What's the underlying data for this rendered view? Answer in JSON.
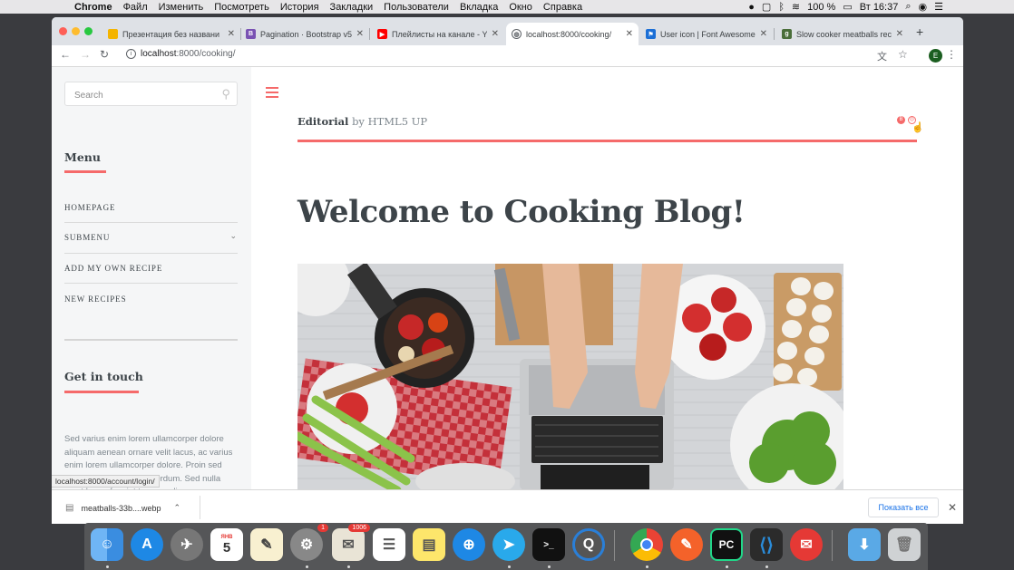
{
  "menubar": {
    "app": "Chrome",
    "items": [
      "Файл",
      "Изменить",
      "Посмотреть",
      "История",
      "Закладки",
      "Пользователи",
      "Вкладка",
      "Окно",
      "Справка"
    ],
    "battery": "100 %",
    "clock": "Вт 16:37"
  },
  "tabs": [
    {
      "title": "Презентация без названи",
      "favicon_color": "#f4b400",
      "active": false
    },
    {
      "title": "Pagination · Bootstrap v5.",
      "favicon_color": "#7952b3",
      "active": false
    },
    {
      "title": "Плейлисты на канале - Y",
      "favicon_color": "#ff0000",
      "active": false
    },
    {
      "title": "localhost:8000/cooking/",
      "favicon_color": "#5f6368",
      "active": true
    },
    {
      "title": "User icon | Font Awesome",
      "favicon_color": "#1c6fd6",
      "active": false
    },
    {
      "title": "Slow cooker meatballs rec",
      "favicon_color": "#4a6e3a",
      "active": false
    }
  ],
  "toolbar": {
    "url_host": "localhost",
    "url_rest": ":8000/cooking/",
    "avatar_letter": "E"
  },
  "sidebar": {
    "search_placeholder": "Search",
    "menu_heading": "Menu",
    "menu_items": [
      "HOMEPAGE",
      "SUBMENU",
      "ADD MY OWN RECIPE",
      "NEW RECIPES"
    ],
    "contact_heading": "Get in touch",
    "contact_text": "Sed varius enim lorem ullamcorper dolore aliquam aenean ornare velit lacus, ac varius enim lorem ullamcorper dolore. Proin sed aliquam facilisis ante interdum. Sed nulla amet lorem feugiat tempus aliquam."
  },
  "status_link": "localhost:8000/account/login/",
  "main": {
    "brand_name": "Editorial",
    "brand_by": "by HTML5 UP",
    "heading": "Welcome to Cooking Blog!"
  },
  "downloads": {
    "file": "meatballs-33b....webp",
    "show_all": "Показать все"
  },
  "dock": {
    "calendar_month": "ЯНВ",
    "calendar_day": "5",
    "prefs_badge": "1",
    "mail_badge": "1006"
  },
  "colors": {
    "accent": "#f56a6a",
    "sidebar_bg": "#f5f6f7",
    "text": "#3d4449"
  }
}
